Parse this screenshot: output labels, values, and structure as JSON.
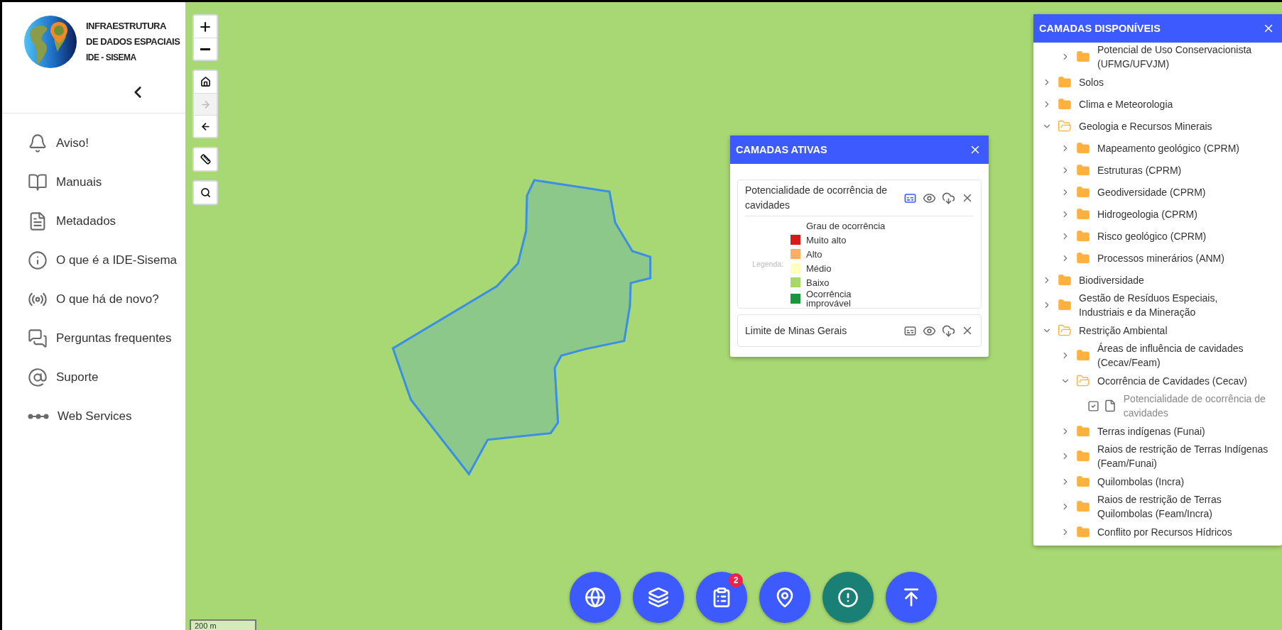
{
  "logo": {
    "lines": [
      "INFRAESTRUTURA",
      "DE DADOS ESPACIAIS",
      "IDE - SISEMA"
    ]
  },
  "sidebar": {
    "items": [
      {
        "kind": "bell",
        "label": "Aviso!"
      },
      {
        "kind": "book",
        "label": "Manuais"
      },
      {
        "kind": "document",
        "label": "Metadados"
      },
      {
        "kind": "info",
        "label": "O que é a IDE-Sisema"
      },
      {
        "kind": "broadcast",
        "label": "O que há de novo?"
      },
      {
        "kind": "chat",
        "label": "Perguntas frequentes"
      },
      {
        "kind": "at",
        "label": "Suporte"
      },
      {
        "kind": "dots",
        "label": "Web Services"
      }
    ]
  },
  "map_tools": [
    {
      "buttons": [
        {
          "kind": "plus",
          "disabled": false
        },
        {
          "kind": "minus",
          "disabled": false
        }
      ]
    },
    {
      "buttons": [
        {
          "kind": "home",
          "disabled": false
        },
        {
          "kind": "forward",
          "disabled": true
        },
        {
          "kind": "back",
          "disabled": false
        }
      ]
    },
    {
      "buttons": [
        {
          "kind": "ruler",
          "disabled": false
        }
      ]
    },
    {
      "buttons": [
        {
          "kind": "search",
          "disabled": false
        }
      ]
    }
  ],
  "scale_bar": {
    "label": "200 m"
  },
  "active_layers": {
    "title": "CAMADAS ATIVAS",
    "layers": [
      {
        "name": "Potencialidade de ocorrência de cavidades",
        "legend_shown": true,
        "legend": {
          "label": "Legenda:",
          "title": "Grau de ocorrência",
          "items": [
            {
              "label": "Muito alto",
              "color": "#d7191c"
            },
            {
              "label": "Alto",
              "color": "#fdae61"
            },
            {
              "label": "Médio",
              "color": "#ffffbf"
            },
            {
              "label": "Baixo",
              "color": "#a6d96a"
            },
            {
              "label": "Ocorrência improvável",
              "color": "#1a9641"
            }
          ]
        }
      },
      {
        "name": "Limite de Minas Gerais",
        "legend_shown": false
      }
    ]
  },
  "available_layers": {
    "title": "CAMADAS DISPONÍVEIS",
    "tree": [
      {
        "kind": "folder",
        "label": "Potencial de Uso Conservacionista (UFMG/UFVJM)",
        "expanded": false,
        "nested": true
      },
      {
        "kind": "folder",
        "label": "Solos",
        "expanded": false
      },
      {
        "kind": "folder",
        "label": "Clima e Meteorologia",
        "expanded": false
      },
      {
        "kind": "folder",
        "label": "Geologia e Recursos Minerais",
        "expanded": true,
        "children": [
          {
            "kind": "folder",
            "label": "Mapeamento geológico (CPRM)",
            "expanded": false
          },
          {
            "kind": "folder",
            "label": "Estruturas (CPRM)",
            "expanded": false
          },
          {
            "kind": "folder",
            "label": "Geodiversidade (CPRM)",
            "expanded": false
          },
          {
            "kind": "folder",
            "label": "Hidrogeologia (CPRM)",
            "expanded": false
          },
          {
            "kind": "folder",
            "label": "Risco geológico (CPRM)",
            "expanded": false
          },
          {
            "kind": "folder",
            "label": "Processos minerários (ANM)",
            "expanded": false
          }
        ]
      },
      {
        "kind": "folder",
        "label": "Biodiversidade",
        "expanded": false
      },
      {
        "kind": "folder",
        "label": "Gestão de Resíduos Especiais, Industriais e da Mineração",
        "expanded": false
      },
      {
        "kind": "folder",
        "label": "Restrição Ambiental",
        "expanded": true,
        "children": [
          {
            "kind": "folder",
            "label": "Áreas de influência de cavidades (Cecav/Feam)",
            "expanded": false
          },
          {
            "kind": "folder",
            "label": "Ocorrência de Cavidades (Cecav)",
            "expanded": true,
            "children": [
              {
                "kind": "layer",
                "label": "Potencialidade de ocorrência de cavidades",
                "checked": true
              }
            ]
          },
          {
            "kind": "folder",
            "label": "Terras indígenas (Funai)",
            "expanded": false
          },
          {
            "kind": "folder",
            "label": "Raios de restrição de Terras Indígenas (Feam/Funai)",
            "expanded": false
          },
          {
            "kind": "folder",
            "label": "Quilombolas (Incra)",
            "expanded": false
          },
          {
            "kind": "folder",
            "label": "Raios de restrição de Terras Quilombolas (Feam/Incra)",
            "expanded": false
          },
          {
            "kind": "folder",
            "label": "Conflito por Recursos Hídricos",
            "expanded": false
          }
        ]
      }
    ]
  },
  "action_buttons": [
    {
      "kind": "globe",
      "color": "#3d5afe"
    },
    {
      "kind": "layers",
      "color": "#3d5afe"
    },
    {
      "kind": "list",
      "color": "#3d5afe",
      "badge": "2"
    },
    {
      "kind": "pin-edit",
      "color": "#3d5afe"
    },
    {
      "kind": "alert",
      "color": "#1a7f74"
    },
    {
      "kind": "upload",
      "color": "#3d5afe"
    }
  ]
}
